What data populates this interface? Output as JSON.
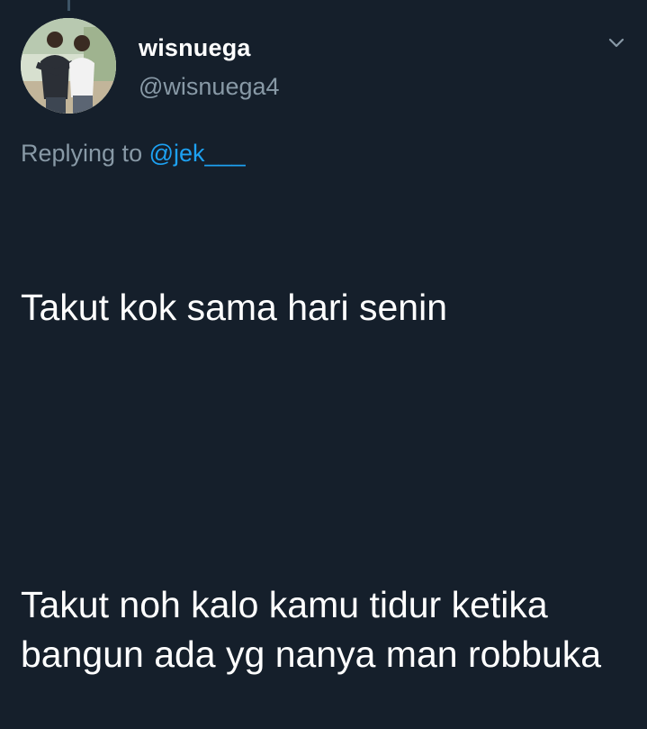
{
  "user": {
    "display_name": "wisnuega",
    "handle": "@wisnuega4",
    "avatar_icon": "profile-photo"
  },
  "menu": {
    "icon": "chevron-down-icon"
  },
  "reply": {
    "prefix": "Replying to",
    "mention": "@jek___"
  },
  "tweet": {
    "line1": "Takut kok sama hari senin",
    "line2": "Takut noh kalo kamu tidur ketika bangun ada yg nanya man robbuka"
  },
  "colors": {
    "background": "#151f2b",
    "secondary_text": "#8899a6",
    "accent": "#1da1f2"
  }
}
